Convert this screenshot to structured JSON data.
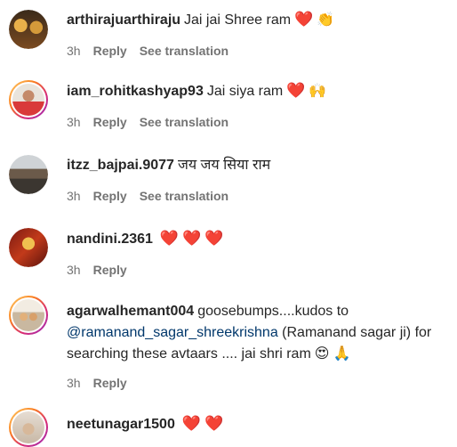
{
  "comments": [
    {
      "username": "arthirajuarthiraju",
      "text": "Jai jai Shree ram",
      "emoji": [
        "❤️",
        "👏"
      ],
      "time": "3h",
      "reply": "Reply",
      "translation": "See translation"
    },
    {
      "username": "iam_rohitkashyap93",
      "text": "Jai siya ram",
      "emoji": [
        "❤️",
        "🙌"
      ],
      "time": "3h",
      "reply": "Reply",
      "translation": "See translation"
    },
    {
      "username": "itzz_bajpai.9077",
      "text": "जय जय सिया राम",
      "time": "3h",
      "reply": "Reply",
      "translation": "See translation"
    },
    {
      "username": "nandini.2361",
      "emoji": [
        "❤️",
        "❤️",
        "❤️"
      ],
      "time": "3h",
      "reply": "Reply"
    },
    {
      "username": "agarwalhemant004",
      "text_before": "goosebumps....kudos to",
      "mention": "@ramanand_sagar_shreekrishna",
      "text_after": "(Ramanand sagar ji) for searching these avtaars .... jai shri ram",
      "emoji": [
        "😍",
        "🙏"
      ],
      "time": "3h",
      "reply": "Reply"
    },
    {
      "username": "neetunagar1500",
      "emoji": [
        "❤️",
        "❤️"
      ]
    }
  ],
  "colors": {
    "text": "#262626",
    "meta": "#737373",
    "mention": "#00376b",
    "heart": "#e0245e",
    "story_ring": [
      "#feda75",
      "#fa7e1e",
      "#d62976",
      "#962fbf"
    ]
  }
}
